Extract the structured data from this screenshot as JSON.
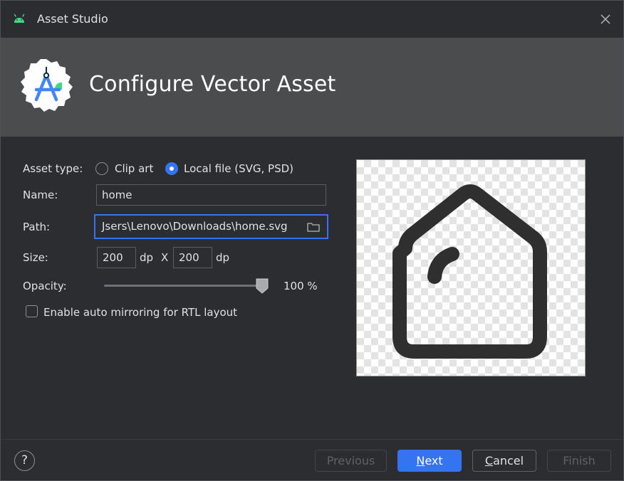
{
  "window": {
    "title": "Asset Studio",
    "icon": "android-icon",
    "close_icon": "close-icon"
  },
  "banner": {
    "heading": "Configure Vector Asset",
    "logo": "android-studio-logo"
  },
  "form": {
    "asset_type_label": "Asset type:",
    "asset_type_options": [
      {
        "label": "Clip art",
        "selected": false
      },
      {
        "label": "Local file (SVG, PSD)",
        "selected": true
      }
    ],
    "name_label": "Name:",
    "name_value": "home",
    "path_label": "Path:",
    "path_value": "Jsers\\Lenovo\\Downloads\\home.svg",
    "path_browse_icon": "folder-icon",
    "size_label": "Size:",
    "size_width": "200",
    "size_width_unit": "dp",
    "size_separator": "X",
    "size_height": "200",
    "size_height_unit": "dp",
    "opacity_label": "Opacity:",
    "opacity_value": "100 %",
    "opacity_level": 1.0,
    "rtl_label": "Enable auto mirroring for RTL layout",
    "rtl_checked": false
  },
  "preview": {
    "icon": "home-icon"
  },
  "footer": {
    "help_label": "?",
    "previous_label": "Previous",
    "next_mnemonic": "N",
    "next_rest": "ext",
    "cancel_mnemonic": "C",
    "cancel_rest": "ancel",
    "finish_label": "Finish"
  },
  "colors": {
    "accent": "#3574f0",
    "background": "#2b2d30",
    "banner": "#4b4c4e"
  }
}
